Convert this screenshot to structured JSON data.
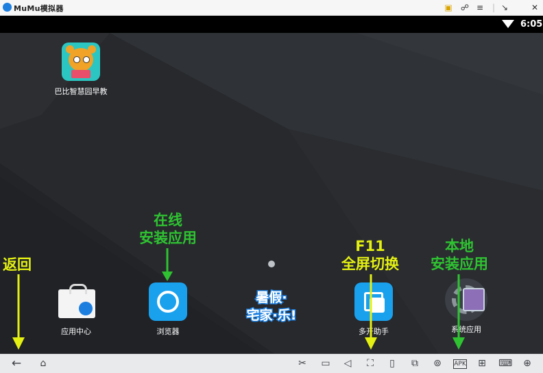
{
  "titlebar": {
    "app_name": "MuMu模拟器",
    "icons": [
      "gift-icon",
      "account-icon",
      "menu-icon",
      "divider",
      "shrink-icon",
      "close-icon"
    ]
  },
  "statusbar": {
    "time": "6:05",
    "icons": [
      "wifi-icon"
    ]
  },
  "desktop": {
    "apps": [
      {
        "label": "巴比智慧园早教",
        "icon": "bear-icon"
      },
      {
        "label": "应用中心",
        "icon": "app-center-bag-icon"
      },
      {
        "label": "浏览器",
        "icon": "browser-ring-icon"
      },
      {
        "label": "暑假·宅家·乐!",
        "icon": "summer-promo-icon"
      },
      {
        "label": "多开助手",
        "icon": "multi-window-icon"
      },
      {
        "label": "系统应用",
        "icon": "settings-gear-icon"
      }
    ]
  },
  "annotations": [
    {
      "text": "在线\n安装应用",
      "color": "#2fc332"
    },
    {
      "text": "返回",
      "color": "#e4f012"
    },
    {
      "text": "F11\n全屏切换",
      "color": "#e4f012"
    },
    {
      "text": "本地\n安装应用",
      "color": "#2fc332"
    }
  ],
  "annotation_lines": {
    "online_1": "在线",
    "online_2": "安装应用",
    "back": "返回",
    "f11_1": "F11",
    "f11_2": "全屏切换",
    "local_1": "本地",
    "local_2": "安装应用"
  },
  "navbar": {
    "left": [
      "back-icon",
      "home-icon"
    ],
    "right": [
      "scissors-icon",
      "folder-icon",
      "volume-icon",
      "fullscreen-icon",
      "shake-icon",
      "rotate-icon",
      "location-icon",
      "apk-icon",
      "toolbox-icon",
      "keyboard-icon",
      "gamepad-icon"
    ]
  },
  "colors": {
    "annotation_yellow": "#e4f012",
    "annotation_green": "#2fc332",
    "brand_blue": "#1c7fe0"
  }
}
